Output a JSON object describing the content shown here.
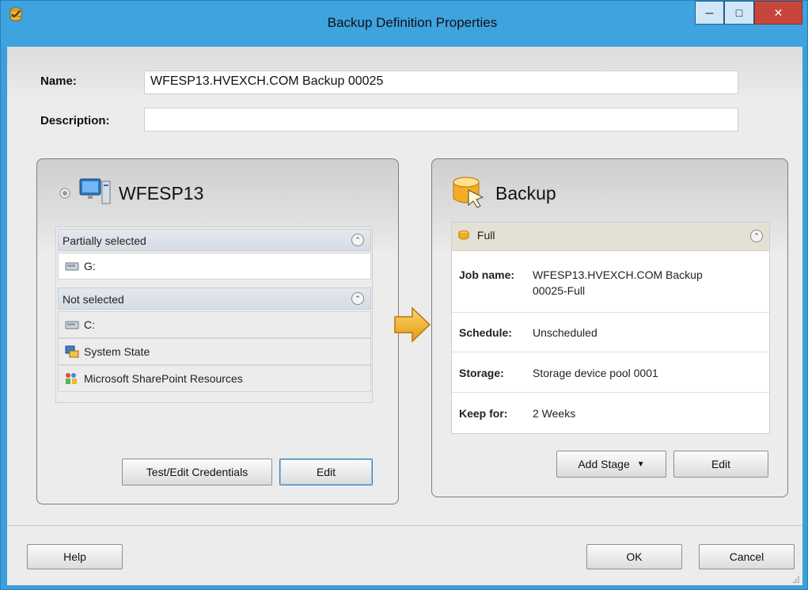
{
  "window": {
    "title": "Backup Definition Properties",
    "controls": {
      "minimize": "minimize-icon",
      "maximize": "maximize-icon",
      "close": "close-icon"
    }
  },
  "form": {
    "name_label": "Name:",
    "name_value": "WFESP13.HVEXCH.COM Backup 00025",
    "description_label": "Description:",
    "description_value": ""
  },
  "selection": {
    "server_name": "WFESP13",
    "groups": [
      {
        "label": "Partially selected",
        "items": [
          {
            "icon": "drive-icon",
            "label": "G:"
          }
        ]
      },
      {
        "label": "Not selected",
        "items": [
          {
            "icon": "drive-icon",
            "label": "C:"
          },
          {
            "icon": "system-state-icon",
            "label": "System State"
          },
          {
            "icon": "sharepoint-icon",
            "label": "Microsoft SharePoint Resources"
          }
        ]
      }
    ],
    "test_credentials_button": "Test/Edit Credentials",
    "edit_button": "Edit"
  },
  "backup": {
    "title": "Backup",
    "stage_label": "Full",
    "details": [
      {
        "label": "Job name:",
        "value": "WFESP13.HVEXCH.COM Backup 00025-Full"
      },
      {
        "label": "Schedule:",
        "value": "Unscheduled"
      },
      {
        "label": "Storage:",
        "value": "Storage device pool 0001"
      },
      {
        "label": "Keep for:",
        "value": "2 Weeks"
      }
    ],
    "add_stage_button": "Add Stage",
    "edit_button": "Edit"
  },
  "footer": {
    "help_button": "Help",
    "ok_button": "OK",
    "cancel_button": "Cancel"
  },
  "colors": {
    "title_bar": "#3ea3df",
    "close_button": "#c7463c",
    "arrow": "#f2b233"
  }
}
